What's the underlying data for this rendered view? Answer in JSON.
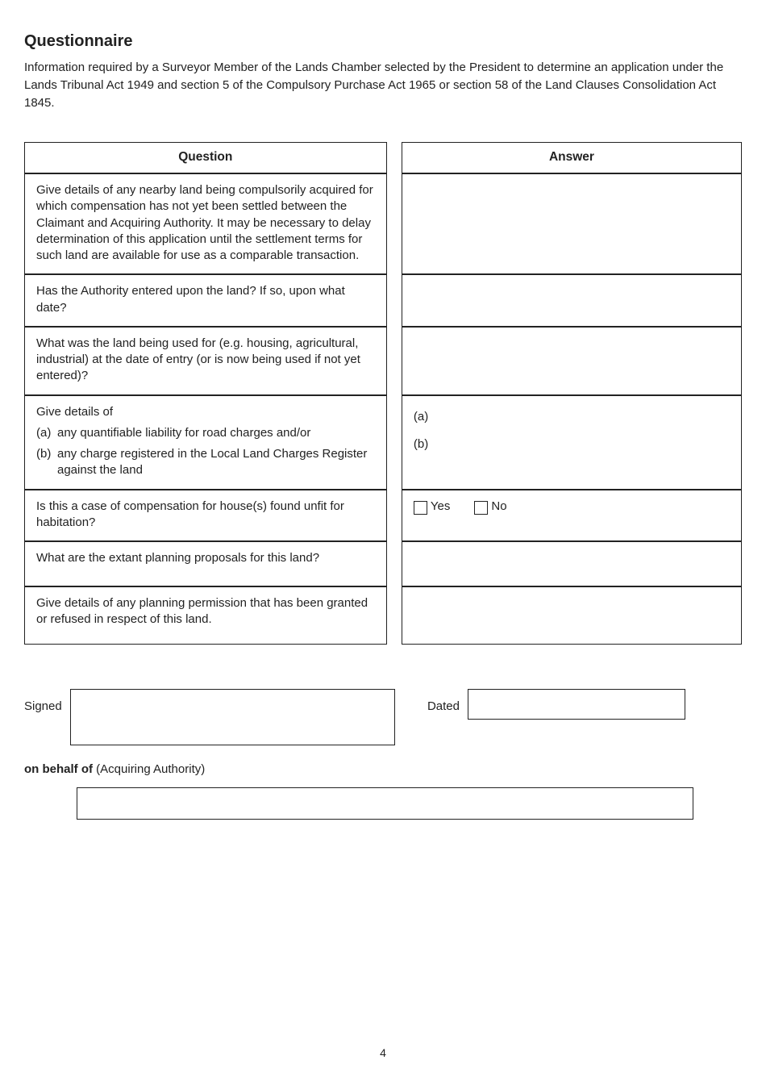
{
  "title": "Questionnaire",
  "intro": "Information required by a Surveyor Member of the Lands Chamber selected by the President to determine an application under the Lands Tribunal Act 1949 and section 5 of the Compulsory Purchase Act 1965 or section 58 of the Land Clauses Consolidation Act 1845.",
  "headers": {
    "question": "Question",
    "answer": "Answer"
  },
  "rows": {
    "r1": {
      "q": "Give details of any nearby land being compulsorily acquired for which compensation has not yet been settled between the Claimant and Acquiring Authority.  It may be necessary to delay determination of this application until the settlement terms for such land are available for use as a comparable transaction.",
      "a": ""
    },
    "r2": {
      "q": "Has the Authority entered upon the land?  If so, upon what date?",
      "a": ""
    },
    "r3": {
      "q": "What was the land being used for (e.g. housing, agricultural, industrial) at the date of entry (or is now being used if not yet entered)?",
      "a": ""
    },
    "r4": {
      "q_lead": "Give details of",
      "q_a_tag": "(a)",
      "q_a_text": "any quantifiable liability for road charges and/or",
      "q_b_tag": "(b)",
      "q_b_text": "any charge registered in the Local Land Charges Register against the land",
      "a_a": "(a)",
      "a_b": "(b)"
    },
    "r5": {
      "q": "Is this a case of compensation for house(s) found unfit for habitation?",
      "yes": "Yes",
      "no": "No"
    },
    "r6": {
      "q": "What are the extant planning proposals for this land?",
      "a": ""
    },
    "r7": {
      "q": "Give details of any planning permission that has been granted or refused in respect of this land.",
      "a": ""
    }
  },
  "signed_label": "Signed",
  "dated_label": "Dated",
  "behalf_prefix": "on behalf of ",
  "behalf_role": "(Acquiring Authority)",
  "page_number": "4"
}
